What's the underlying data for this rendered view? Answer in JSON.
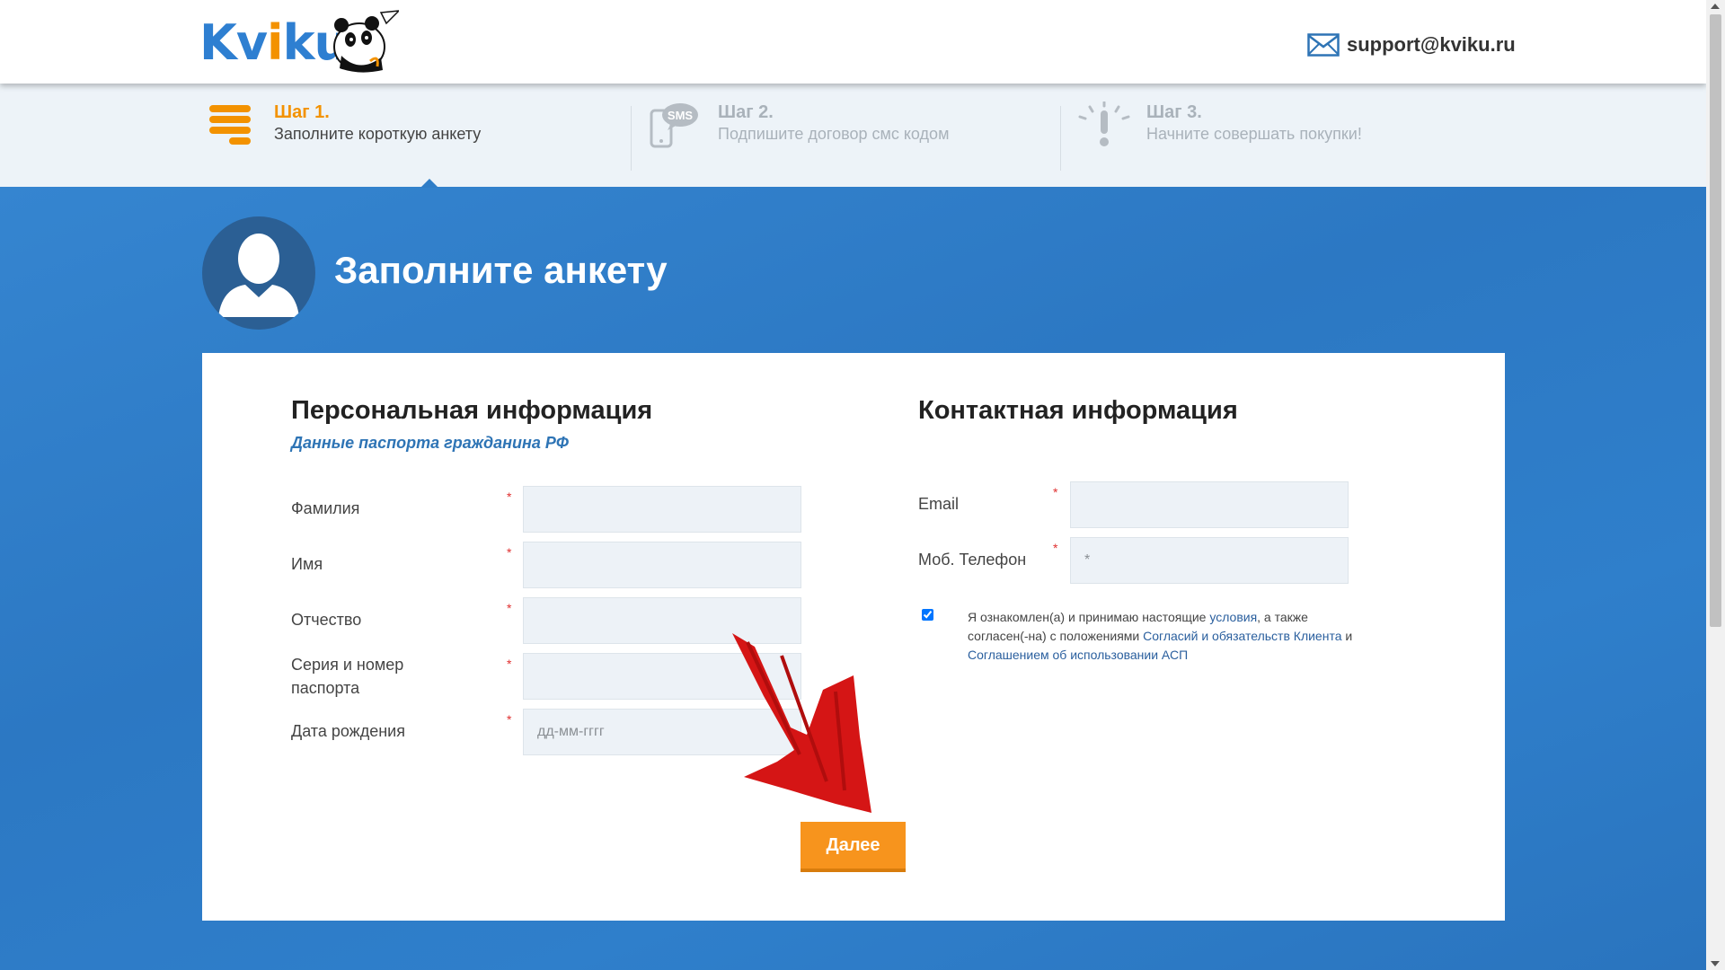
{
  "header": {
    "logo": {
      "prefix": "Kv",
      "i": "i",
      "suffix": "ku"
    },
    "support_email": "support@kviku.ru"
  },
  "steps": [
    {
      "num": "Шаг 1.",
      "desc": "Заполните короткую анкету",
      "icon": "list-icon",
      "active": true
    },
    {
      "num": "Шаг 2.",
      "desc": "Подпишите договор смс кодом",
      "icon": "sms-phone-icon",
      "active": false
    },
    {
      "num": "Шаг 3.",
      "desc": "Начните совершать покупки!",
      "icon": "exclamation-icon",
      "active": false
    }
  ],
  "sms_badge": "SMS",
  "hero": {
    "title": "Заполните анкету"
  },
  "personal": {
    "title": "Персональная информация",
    "subtitle": "Данные паспорта гражданина РФ",
    "fields": [
      {
        "label": "Фамилия",
        "value": "",
        "placeholder": ""
      },
      {
        "label": "Имя",
        "value": "",
        "placeholder": ""
      },
      {
        "label": "Отчество",
        "value": "",
        "placeholder": ""
      },
      {
        "label": "Серия и номер паспорта",
        "value": "",
        "placeholder": ""
      },
      {
        "label": "Дата рождения",
        "value": "",
        "placeholder": "дд-мм-гггг"
      }
    ]
  },
  "contact": {
    "title": "Контактная информация",
    "fields": [
      {
        "label": "Email",
        "value": "",
        "placeholder": ""
      },
      {
        "label": "Моб. Телефон",
        "value": "",
        "placeholder": "*"
      }
    ]
  },
  "required_mark": "*",
  "agreement": {
    "checked": true,
    "text1": "Я ознакомлен(а) и принимаю настоящие",
    "link1": "условия",
    "text2": ", а также согласен(-на) с положениями",
    "link2": "Согласий и обязательств Клиента",
    "text3": " и",
    "link3": "Соглашением об использовании АСП"
  },
  "next_button": "Далее",
  "colors": {
    "brand_blue": "#2e7fd1",
    "accent_orange": "#f39200",
    "button_orange": "#f7941d",
    "hero_blue": "#2f7dc7",
    "link_blue": "#2a5f9e",
    "required_red": "#e03030",
    "annotation_arrow": "#d51515"
  }
}
